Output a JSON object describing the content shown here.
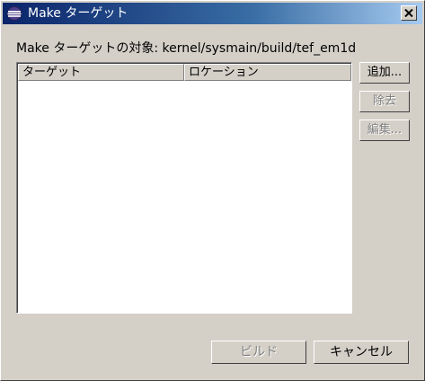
{
  "window": {
    "title": "Make ターゲット"
  },
  "target_label": "Make ターゲットの対象: kernel/sysmain/build/tef_em1d",
  "table": {
    "columns": [
      "ターゲット",
      "ロケーション"
    ],
    "rows": []
  },
  "side_buttons": {
    "add": "追加...",
    "remove": "除去",
    "edit": "編集..."
  },
  "footer": {
    "build": "ビルド",
    "cancel": "キャンセル"
  },
  "icons": {
    "title_icon": "eclipse-icon",
    "close_icon": "close-icon"
  },
  "colors": {
    "titlebar_start": "#0a246a",
    "titlebar_end": "#a6caf0",
    "window_bg": "#d4d0c8"
  }
}
